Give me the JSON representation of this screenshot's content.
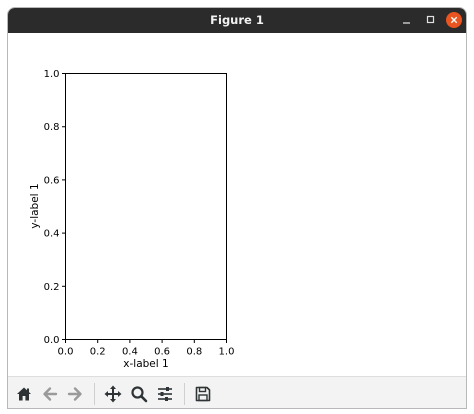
{
  "window": {
    "title": "Figure 1"
  },
  "toolbar": {
    "buttons": [
      "home-icon",
      "back-arrow-icon",
      "forward-arrow-icon",
      "pan-icon",
      "zoom-icon",
      "configure-subplots-icon",
      "save-icon"
    ]
  },
  "colors": {
    "titlebar": "#2b2b2b",
    "close_button": "#e95420",
    "toolbar_icon": "#2e3436",
    "toolbar_icon_disabled": "#9a9a9a"
  },
  "chart_data": {
    "type": "scatter",
    "title": "",
    "xlabel": "x-label 1",
    "ylabel": "y-label 1",
    "xlim": [
      0.0,
      1.0
    ],
    "ylim": [
      0.0,
      1.0
    ],
    "xticks": [
      "0.0",
      "0.2",
      "0.4",
      "0.6",
      "0.8",
      "1.0"
    ],
    "yticks": [
      "0.0",
      "0.2",
      "0.4",
      "0.6",
      "0.8",
      "1.0"
    ],
    "series": [],
    "grid": false,
    "legend": "none"
  }
}
